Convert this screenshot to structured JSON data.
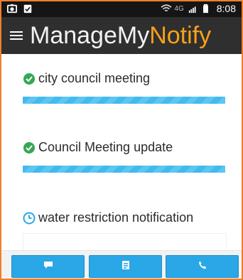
{
  "status_bar": {
    "left_icons": [
      "photo-icon",
      "clipboard-check-icon"
    ],
    "signal_text": "4G",
    "time": "8:08"
  },
  "app_bar": {
    "menu_icon": "menu-icon",
    "title_part1": "ManageMy",
    "title_part2": "Notify",
    "title_color_part2": "#f6a11b"
  },
  "notifications": [
    {
      "icon": "check-circle-icon",
      "label": "city council meeting",
      "progress": 1.0
    },
    {
      "icon": "check-circle-icon",
      "label": "Council Meeting update",
      "progress": 1.0
    },
    {
      "icon": "clock-icon",
      "label": "water restriction notification"
    }
  ],
  "bottom_actions": [
    {
      "icon": "chat-icon"
    },
    {
      "icon": "document-icon"
    },
    {
      "icon": "phone-icon"
    }
  ],
  "colors": {
    "accent_orange": "#f07f2b",
    "check_green": "#34a853",
    "progress_blue": "#43b9ee",
    "clock_blue": "#2aa7e6"
  }
}
